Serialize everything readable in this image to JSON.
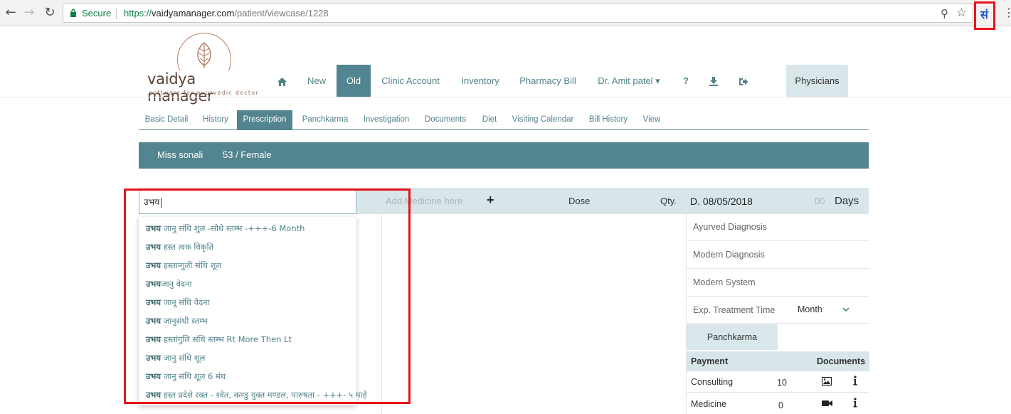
{
  "browser": {
    "secure_label": "Secure",
    "url_scheme": "https://",
    "url_host": "vaidyamanager.com",
    "url_path": "/patient/viewcase/1228",
    "extension_glyph": "सं"
  },
  "logo": {
    "name": "vaidya manager",
    "tagline": "software for ayurvedic doctor"
  },
  "topnav": {
    "new": "New",
    "old": "Old",
    "clinic": "Clinic Account",
    "inventory": "Inventory",
    "pharmacy": "Pharmacy Bill",
    "doctor": "Dr. Amit patel ▾",
    "help": "?",
    "physicians": "Physicians"
  },
  "subtabs": [
    "Basic Detail",
    "History",
    "Prescription",
    "Panchkarma",
    "Investigation",
    "Documents",
    "Diet",
    "Visiting Calendar",
    "Bill History",
    "View"
  ],
  "patient": {
    "name": "Miss sonali",
    "age_gender": "53 / Female"
  },
  "rx": {
    "medicine_value": "उभय",
    "medicine_placeholder": "Add Medicine here",
    "plus": "+",
    "dose": "Dose",
    "qty": "Qty.",
    "date": "D. 08/05/2018",
    "days_value": "00",
    "days_label": "Days"
  },
  "suggestions": [
    {
      "bold": "उभय",
      "rest": " जानु संधि शुल -सोथे स्तम्भ -+++-6 Month"
    },
    {
      "bold": "उभय",
      "rest": " हस्त त्वक विकृति"
    },
    {
      "bold": "उभय",
      "rest": " हस्तान्गुली संधि शूल"
    },
    {
      "bold": "उभय",
      "rest": "जानु वेदना"
    },
    {
      "bold": "उभय",
      "rest": " जानू संधि वेदना"
    },
    {
      "bold": "उभय",
      "rest": " जानुसंधी स्तम्भ"
    },
    {
      "bold": "उभय",
      "rest": " हस्तांगुलि संधि स्तम्भ Rt More Then Lt"
    },
    {
      "bold": "उभय",
      "rest": " जानु संधि शूल"
    },
    {
      "bold": "उभय",
      "rest": " जानु संधि शूल 6 मंथ"
    },
    {
      "bold": "उभय",
      "rest": " हस्त प्रदेशे रक्त - श्वेत, कण्डु युक्त मण्डल, पारुषता - +++- ५ माहे"
    }
  ],
  "rpanel": {
    "ayurved": "Ayurved Diagnosis",
    "modern": "Modern Diagnosis",
    "system": "Modern System",
    "exp_label": "Exp. Treatment Time",
    "exp_value": "Month",
    "panchkarma": "Panchkarma",
    "payment": "Payment",
    "documents": "Documents",
    "rows": [
      {
        "label": "Consulting",
        "value": "10"
      },
      {
        "label": "Medicine",
        "value": "0"
      }
    ]
  },
  "colors": {
    "teal": "#52858f",
    "light_teal": "#d8e6ea",
    "highlight_red": "#e8141b"
  }
}
